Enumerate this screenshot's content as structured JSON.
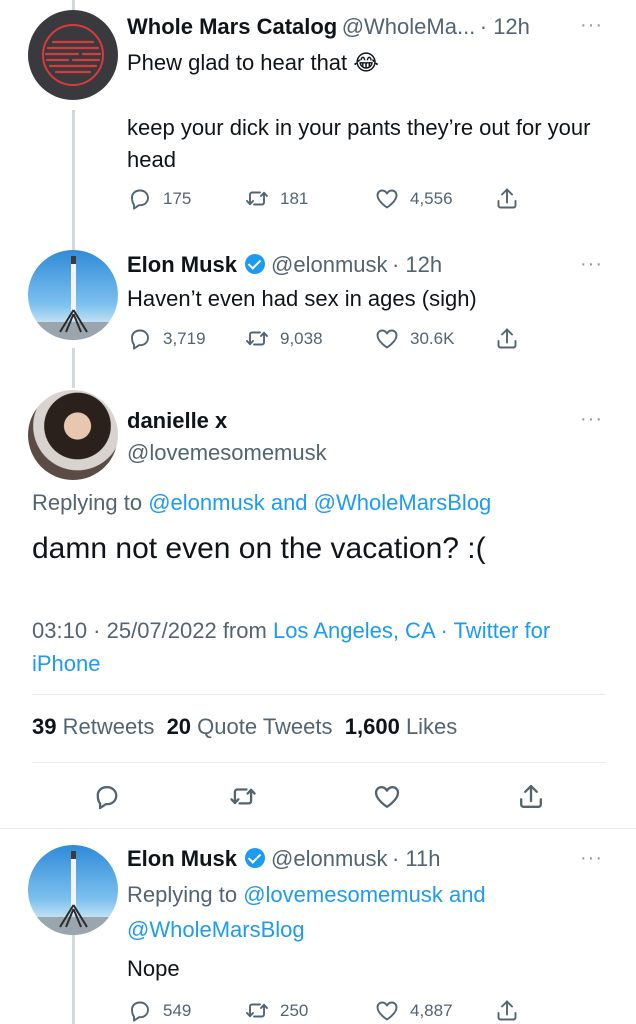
{
  "tweet1": {
    "name": "Whole Mars Catalog",
    "handle": "@WholeMa...",
    "time": "· 12h",
    "more": "···",
    "line1": "Phew glad to hear that",
    "emoji": "😂",
    "line2": "keep your dick in your pants they’re out for your head",
    "replies": "175",
    "retweets": "181",
    "likes": "4,556"
  },
  "tweet2": {
    "name": "Elon Musk",
    "handle": "@elonmusk",
    "time": "· 12h",
    "more": "···",
    "text": "Haven’t even had sex in ages (sigh)",
    "replies": "3,719",
    "retweets": "9,038",
    "likes": "30.6K"
  },
  "main_tweet": {
    "name": "danielle x",
    "handle": "@lovemesomemusk",
    "more": "···",
    "replying_prefix": "Replying to",
    "replying_to_1": "@elonmusk",
    "replying_and": "and",
    "replying_to_2": "@WholeMarsBlog",
    "text": "damn not even on the vacation? :(",
    "timestamp": "03:10 · 25/07/2022 from",
    "location": "Los Angeles, CA",
    "sep": "·",
    "client_1": "Twitter",
    "client_2": "for iPhone",
    "retweets_count": "39",
    "retweets_label": "Retweets",
    "quotes_count": "20",
    "quotes_label": "Quote Tweets",
    "likes_count": "1,600",
    "likes_label": "Likes"
  },
  "tweet4": {
    "name": "Elon Musk",
    "handle": "@elonmusk",
    "time": "· 11h",
    "more": "···",
    "replying_prefix": "Replying to",
    "replying_to_1": "@lovemesomemusk",
    "replying_and": "and",
    "replying_to_2": "@WholeMarsBlog",
    "text": "Nope",
    "replies": "549",
    "retweets": "250",
    "likes": "4,887"
  },
  "colors": {
    "accent": "#1d9bf0",
    "text": "#0f1419",
    "muted": "#536471"
  },
  "icons": [
    "reply-icon",
    "retweet-icon",
    "like-icon",
    "share-icon",
    "verified-icon",
    "more-icon"
  ]
}
